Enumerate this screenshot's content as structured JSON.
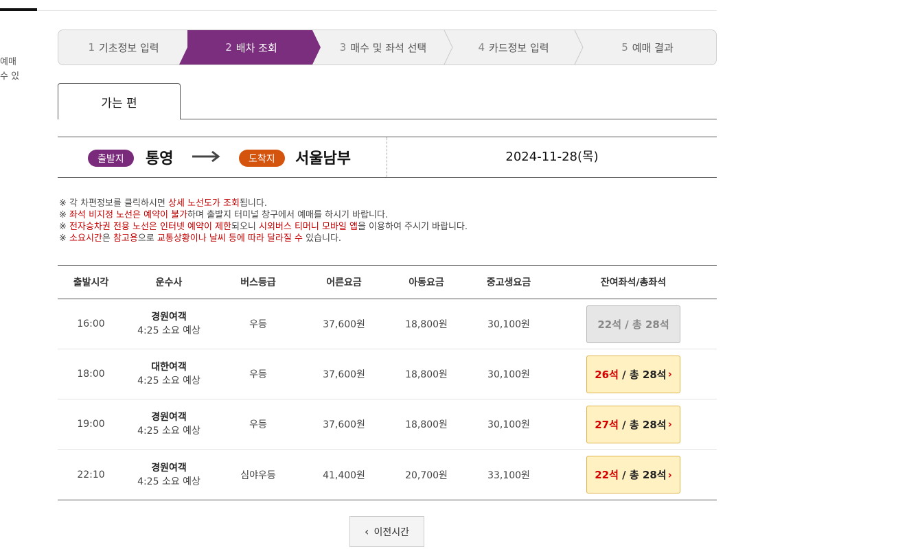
{
  "left_clip": {
    "line1": "예매",
    "line2": "수 있"
  },
  "steps": [
    {
      "num": "1",
      "label": "기초정보 입력"
    },
    {
      "num": "2",
      "label": "배차 조회"
    },
    {
      "num": "3",
      "label": "매수 및 좌석 선택"
    },
    {
      "num": "4",
      "label": "카드정보 입력"
    },
    {
      "num": "5",
      "label": "예매 결과"
    }
  ],
  "colors": {
    "active_step": "#7b2e7e",
    "departure_pill": "#7a2a7a",
    "arrival_pill": "#d4530d",
    "seat_button": "#fff1c2",
    "remaining_seats": "#d40000"
  },
  "direction_tab": "가는 편",
  "route": {
    "departure_label": "출발지",
    "departure_city": "통영",
    "arrival_label": "도착지",
    "arrival_city": "서울남부",
    "date": "2024-11-28(목)"
  },
  "notices": [
    {
      "parts": [
        {
          "t": "※ 각 차편정보를 클릭하시면 "
        },
        {
          "t": "상세 노선도가 조회",
          "red": true
        },
        {
          "t": "됩니다."
        }
      ]
    },
    {
      "parts": [
        {
          "t": "※ "
        },
        {
          "t": "좌석 비지정 노선은 예약이 불가",
          "red": true
        },
        {
          "t": "하며 출발지 터미널 창구에서 예매를 하시기 바랍니다."
        }
      ]
    },
    {
      "parts": [
        {
          "t": "※ "
        },
        {
          "t": "전자승차권 전용 노선은 인터넷 예약이 제한",
          "red": true
        },
        {
          "t": "되오니 "
        },
        {
          "t": "시외버스 티머니 모바일 앱",
          "red": true
        },
        {
          "t": "을 이용하여 주시기 바랍니다."
        }
      ]
    },
    {
      "parts": [
        {
          "t": "※ "
        },
        {
          "t": "소요시간",
          "red": true
        },
        {
          "t": "은 "
        },
        {
          "t": "참고용",
          "red": true
        },
        {
          "t": "으로 "
        },
        {
          "t": "교통상황이나 날씨 등에 따라 달라질 수",
          "red": true
        },
        {
          "t": " 있습니다."
        }
      ]
    }
  ],
  "table": {
    "headers": [
      "출발시각",
      "운수사",
      "버스등급",
      "어른요금",
      "아동요금",
      "중고생요금",
      "잔여좌석/총좌석"
    ],
    "rows": [
      {
        "time": "16:00",
        "company": "경원여객",
        "duration": "4:25 소요 예상",
        "grade": "우등",
        "adult": "37,600원",
        "child": "18,800원",
        "youth": "30,100원",
        "remaining": "22석",
        "total": "/ 총 28석",
        "available": false
      },
      {
        "time": "18:00",
        "company": "대한여객",
        "duration": "4:25 소요 예상",
        "grade": "우등",
        "adult": "37,600원",
        "child": "18,800원",
        "youth": "30,100원",
        "remaining": "26석",
        "total": "/ 총 28석",
        "available": true
      },
      {
        "time": "19:00",
        "company": "경원여객",
        "duration": "4:25 소요 예상",
        "grade": "우등",
        "adult": "37,600원",
        "child": "18,800원",
        "youth": "30,100원",
        "remaining": "27석",
        "total": "/ 총 28석",
        "available": true
      },
      {
        "time": "22:10",
        "company": "경원여객",
        "duration": "4:25 소요 예상",
        "grade": "심야우등",
        "adult": "41,400원",
        "child": "20,700원",
        "youth": "33,100원",
        "remaining": "22석",
        "total": "/ 총 28석",
        "available": true
      }
    ]
  },
  "prev_button": "이전시간"
}
